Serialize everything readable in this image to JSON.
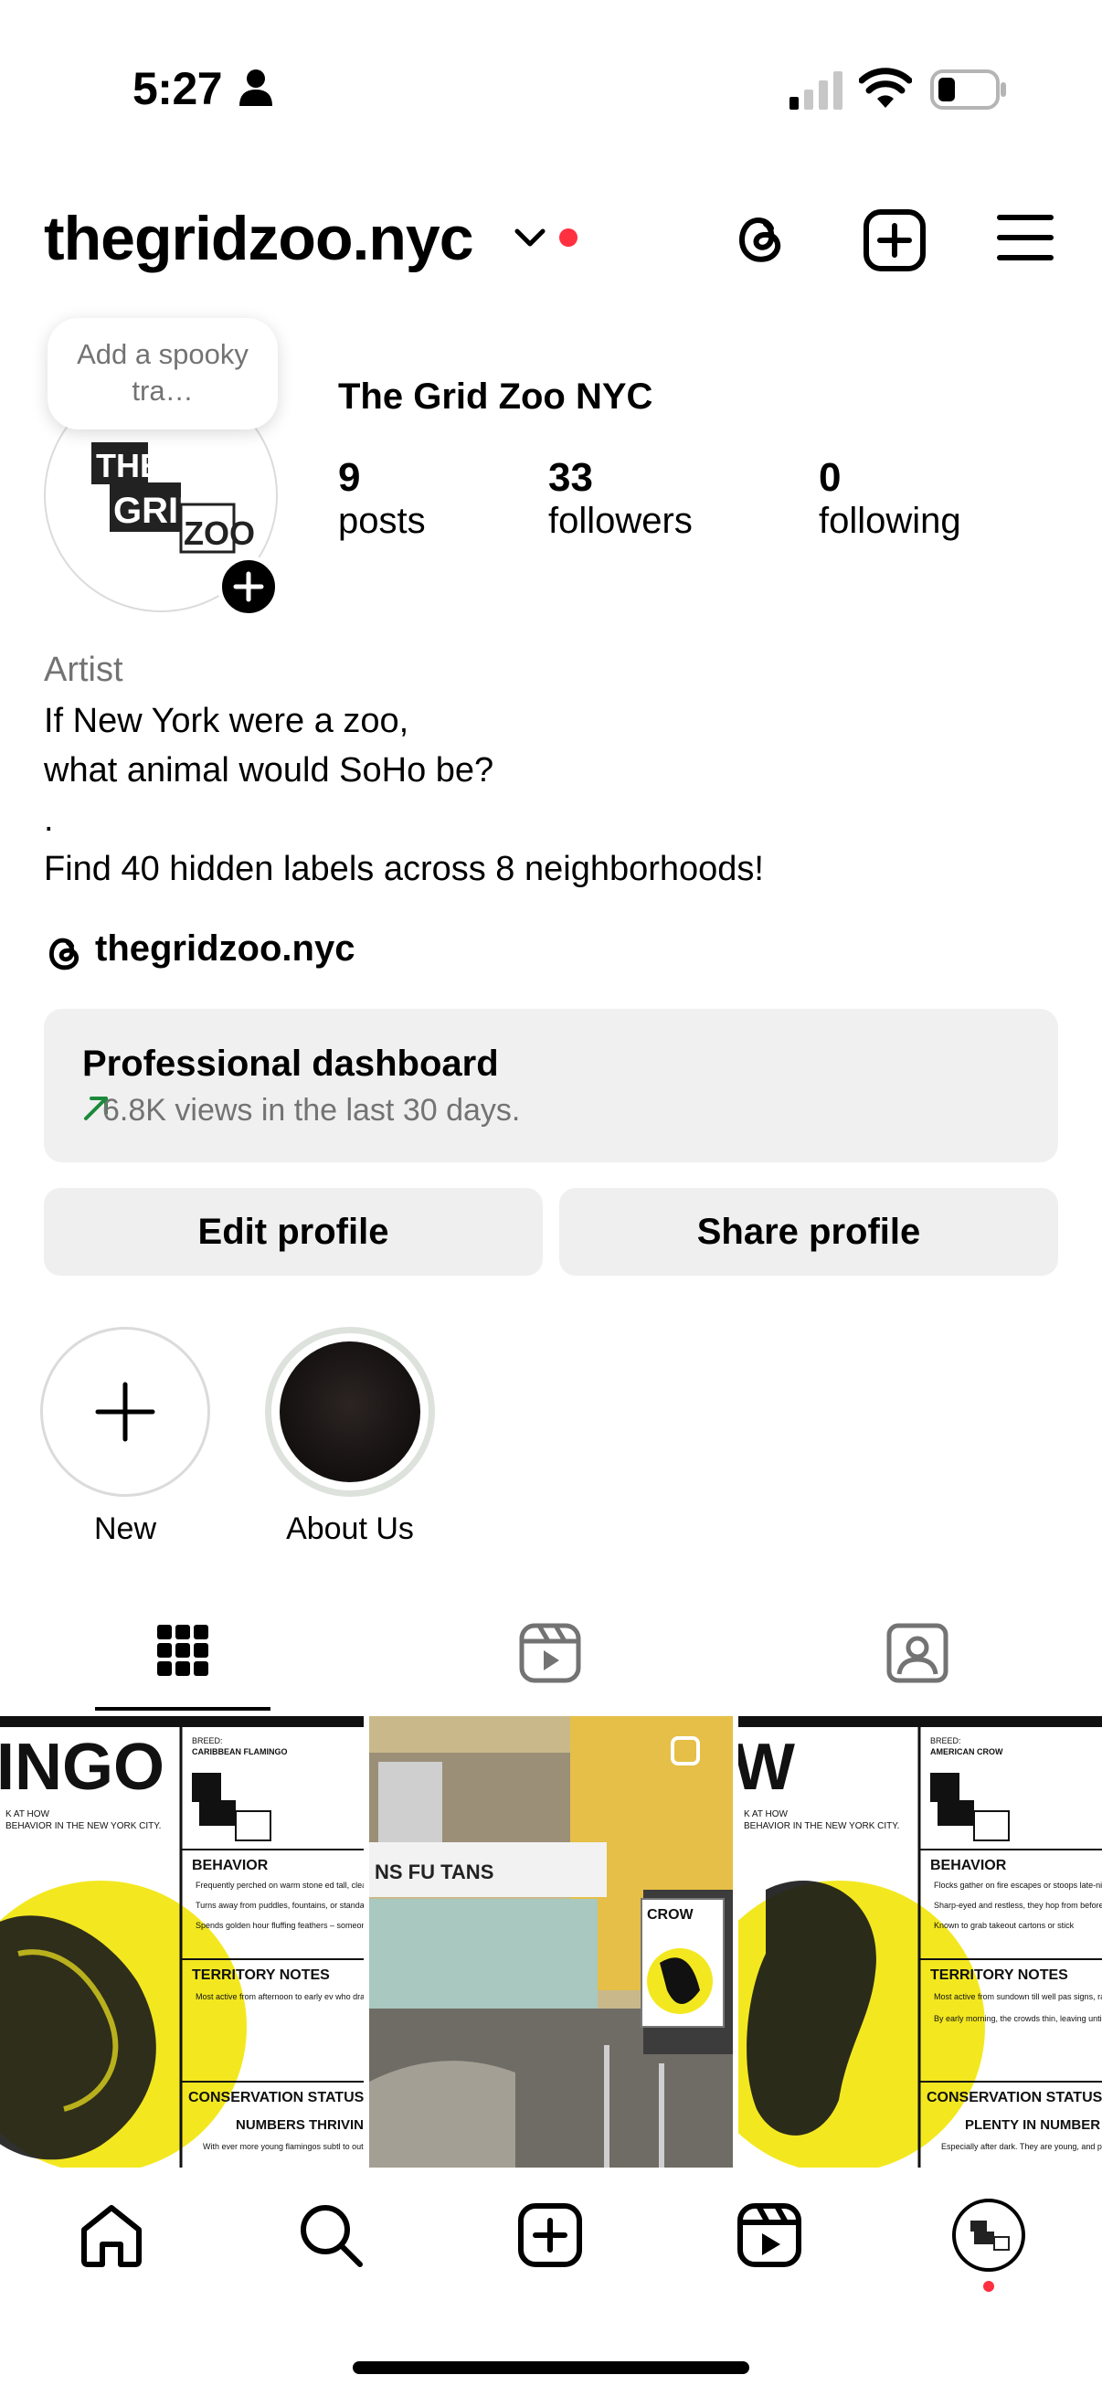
{
  "status_bar": {
    "time": "5:27"
  },
  "header": {
    "username": "thegridzoo.nyc"
  },
  "profile": {
    "story_bubble": "Add a spooky tra…",
    "display_name": "The Grid Zoo NYC",
    "avatar_text": {
      "line1": "THE",
      "line2": "GRID",
      "line3": "ZOO"
    },
    "stats": [
      {
        "value": "9",
        "label": "posts"
      },
      {
        "value": "33",
        "label": "followers"
      },
      {
        "value": "0",
        "label": "following"
      }
    ],
    "category": "Artist",
    "bio": "If New York were a zoo,\nwhat animal would SoHo be?\n.\nFind 40 hidden labels across 8 neighborhoods!",
    "threads_handle": "thegridzoo.nyc"
  },
  "dashboard": {
    "title": "Professional dashboard",
    "subtitle": "6.8K views in the last 30 days.",
    "trend_color": "#1b8a3a"
  },
  "buttons": {
    "edit": "Edit profile",
    "share": "Share profile"
  },
  "highlights": [
    {
      "label": "New"
    },
    {
      "label": "About Us"
    }
  ],
  "tabs": [
    {
      "icon": "grid-icon",
      "active": true
    },
    {
      "icon": "reels-icon",
      "active": false
    },
    {
      "icon": "tagged-icon",
      "active": false
    }
  ],
  "grid": [
    {
      "header": "INGO",
      "breed_label": "BREED:",
      "breed": "CARIBBEAN FLAMINGO",
      "tagline": "K AT HOW\nBEHAVIOR IN THE NEW YORK CITY.",
      "behavior_title": "BEHAVIOR",
      "behavior_items": [
        "Frequently perched on warm stone ed tall, clear vessels left in the sun.",
        "Turns away from puddles, fountains, or standards matter.",
        "Spends golden hour fluffing feathers – someone's peripheral vision."
      ],
      "territory_title": "TERRITORY NOTES",
      "territory_items": [
        "Most active from afternoon to early ev who draws the most eyes, carefully pre"
      ],
      "conservation_title": "CONSERVATION STATUS",
      "conservation_status": "NUMBERS THRIVING",
      "conservation_note": "With ever more young flamingos subtl to outshine one another."
    },
    {
      "storefront": "NS FU TANS",
      "sticker": "CROW"
    },
    {
      "header": "W",
      "breed_label": "BREED:",
      "breed": "AMERICAN CROW",
      "tagline": "K AT HOW\nBEHAVIOR IN THE NEW YORK CITY.",
      "behavior_title": "BEHAVIOR",
      "behavior_items": [
        "Flocks gather on fire escapes or stoops late-night bite.",
        "Sharp-eyed and restless, they hop from before cawing off.",
        "Known to grab takeout cartons or stick"
      ],
      "territory_title": "TERRITORY NOTES",
      "territory_items": [
        "Most active from sundown till well pas signs, ramen joints, dumpling shops, an",
        "By early morning, the crowds thin, leaving until dusk brings them back in force."
      ],
      "conservation_title": "CONSERVATION STATUS",
      "conservation_status": "PLENTY IN NUMBER",
      "conservation_note": "Especially after dark. They are young, and proud to call this turf theirs."
    }
  ],
  "bottom_nav": [
    "home-icon",
    "search-icon",
    "create-icon",
    "reels-icon",
    "profile-avatar"
  ]
}
